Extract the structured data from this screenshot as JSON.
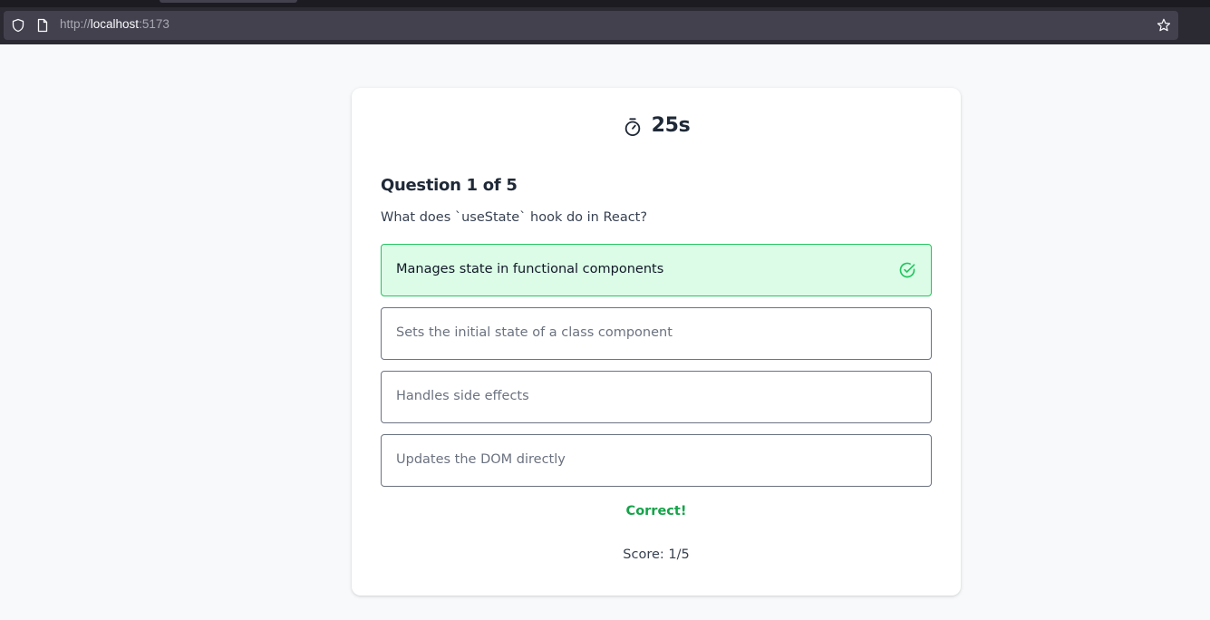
{
  "browser": {
    "url_scheme": "http://",
    "url_host": "localhost",
    "url_port": ":5173"
  },
  "quiz": {
    "timer": "25s",
    "question_heading": "Question 1 of 5",
    "question_text": "What does `useState` hook do in React?",
    "options": [
      {
        "label": "Manages state in functional components",
        "state": "correct"
      },
      {
        "label": "Sets the initial state of a class component",
        "state": "default"
      },
      {
        "label": "Handles side effects",
        "state": "default"
      },
      {
        "label": "Updates the DOM directly",
        "state": "default"
      }
    ],
    "feedback": "Correct!",
    "score": "Score: 1/5"
  },
  "colors": {
    "correct_bg": "#dcfce7",
    "correct_border": "#22c55e",
    "feedback_text": "#16a34a"
  },
  "icons": [
    "shield-icon",
    "page-icon",
    "star-icon",
    "timer-icon",
    "check-circle-icon"
  ]
}
